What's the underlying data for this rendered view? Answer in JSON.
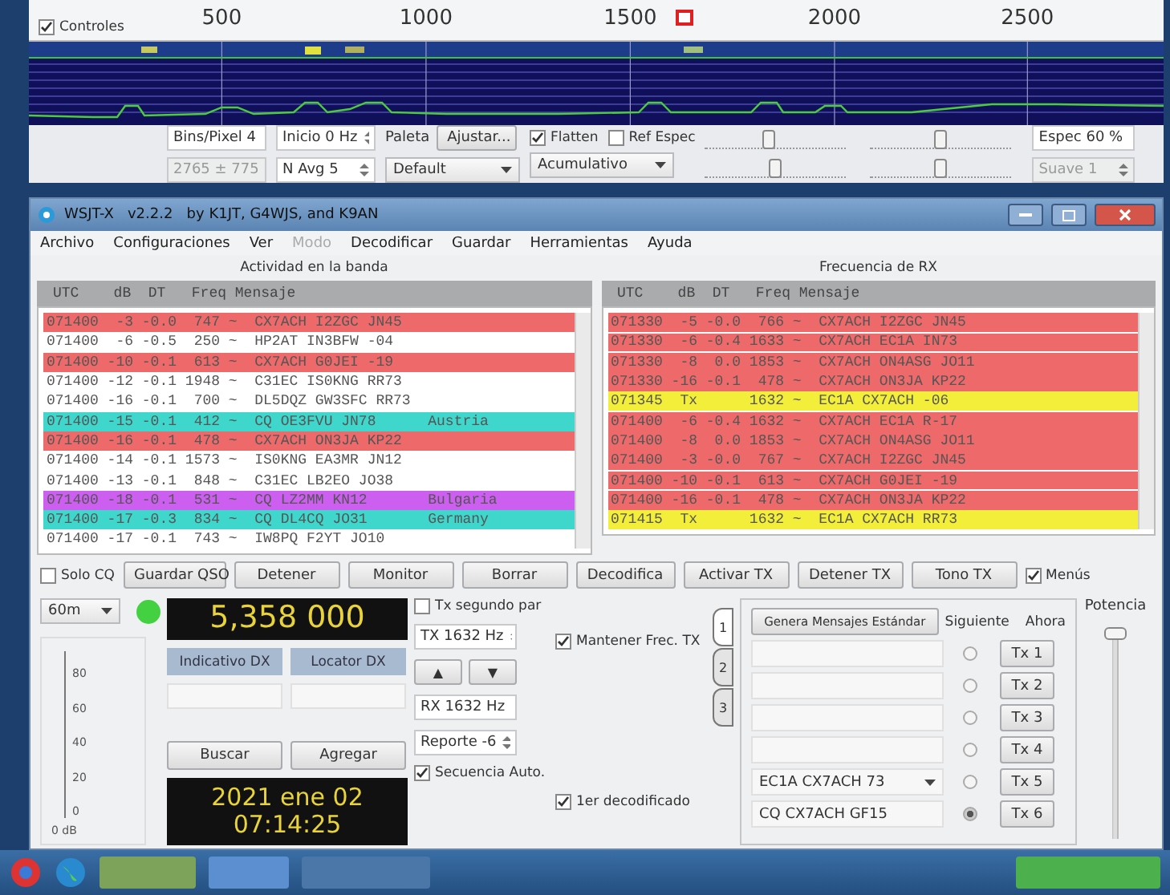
{
  "waterfall": {
    "controls": {
      "label": "Controles",
      "checked": true
    },
    "freq_labels": [
      "500",
      "1000",
      "1500",
      "2000",
      "2500"
    ],
    "bins_per_pixel": "Bins/Pixel 4",
    "start": "Inicio 0 Hz",
    "range": "2765 ± 775",
    "n_avg": "N Avg 5",
    "palette_label": "Paleta",
    "adjust_button": "Ajustar...",
    "palette": "Default",
    "flatten": {
      "label": "Flatten",
      "checked": true
    },
    "ref_spec": {
      "label": "Ref Espec",
      "checked": false
    },
    "mode": "Acumulativo",
    "sliders": [
      {
        "level": 0.45
      },
      {
        "level": 0.5
      },
      {
        "level": 0.5
      },
      {
        "level": 0.5
      }
    ],
    "spec": "Espec 60 %",
    "smooth": "Suave 1"
  },
  "window": {
    "title": "WSJT-X   v2.2.2   by K1JT, G4WJS, and K9AN"
  },
  "menu": [
    {
      "label": "Archivo",
      "disabled": false
    },
    {
      "label": "Configuraciones",
      "disabled": false
    },
    {
      "label": "Ver",
      "disabled": false
    },
    {
      "label": "Modo",
      "disabled": true
    },
    {
      "label": "Decodificar",
      "disabled": false
    },
    {
      "label": "Guardar",
      "disabled": false
    },
    {
      "label": "Herramientas",
      "disabled": false
    },
    {
      "label": "Ayuda",
      "disabled": false
    }
  ],
  "band_activity": {
    "title": "Actividad en la banda",
    "columns": [
      "UTC",
      "dB",
      "DT",
      "Freq",
      "Mensaje"
    ],
    "rows": [
      {
        "line": "071400  -3 -0.0  747 ~  CX7ACH I2ZGC JN45",
        "color": "#ee6a6a"
      },
      {
        "line": "071400  -6 -0.5  250 ~  HP2AT IN3BFW -04",
        "color": "#ffffff"
      },
      {
        "line": "071400 -10 -0.1  613 ~  CX7ACH G0JEI -19",
        "color": "#ee6a6a"
      },
      {
        "line": "071400 -12 -0.1 1948 ~  C31EC IS0KNG RR73",
        "color": "#ffffff"
      },
      {
        "line": "071400 -16 -0.1  700 ~  DL5DQZ GW3SFC RR73",
        "color": "#ffffff"
      },
      {
        "line": "071400 -15 -0.1  412 ~  CQ OE3FVU JN78",
        "country": "Austria",
        "color": "#3fd6cc"
      },
      {
        "line": "071400 -16 -0.1  478 ~  CX7ACH ON3JA KP22",
        "color": "#ee6a6a"
      },
      {
        "line": "071400 -14 -0.1 1573 ~  IS0KNG EA3MR JN12",
        "color": "#ffffff"
      },
      {
        "line": "071400 -13 -0.1  848 ~  C31EC LB2EO JO38",
        "color": "#ffffff"
      },
      {
        "line": "071400 -18 -0.1  531 ~  CQ LZ2MM KN12",
        "country": "Bulgaria",
        "color": "#cc5ff0"
      },
      {
        "line": "071400 -17 -0.3  834 ~  CQ DL4CQ JO31",
        "country": "Germany",
        "color": "#3fd6cc"
      },
      {
        "line": "071400 -17 -0.1  743 ~  IW8PQ F2YT JO10",
        "color": "#ffffff"
      }
    ]
  },
  "rx_frequency": {
    "title": "Frecuencia de RX",
    "columns": [
      "UTC",
      "dB",
      "DT",
      "Freq",
      "Mensaje"
    ],
    "rows": [
      {
        "line": "071330  -5 -0.0  766 ~  CX7ACH I2ZGC JN45",
        "color": "#ee6a6a"
      },
      {
        "line": "071330  -6 -0.4 1633 ~  CX7ACH EC1A IN73",
        "color": "#ee6a6a"
      },
      {
        "line": "071330  -8  0.0 1853 ~  CX7ACH ON4ASG JO11",
        "color": "#ee6a6a"
      },
      {
        "line": "071330 -16 -0.1  478 ~  CX7ACH ON3JA KP22",
        "color": "#ee6a6a"
      },
      {
        "line": "071345  Tx      1632 ~  EC1A CX7ACH -06",
        "color": "#f2ee3a"
      },
      {
        "line": "071400  -6 -0.4 1632 ~  CX7ACH EC1A R-17",
        "color": "#ee6a6a"
      },
      {
        "line": "071400  -8  0.0 1853 ~  CX7ACH ON4ASG JO11",
        "color": "#ee6a6a"
      },
      {
        "line": "071400  -3 -0.0  767 ~  CX7ACH I2ZGC JN45",
        "color": "#ee6a6a"
      },
      {
        "line": "071400 -10 -0.1  613 ~  CX7ACH G0JEI -19",
        "color": "#ee6a6a"
      },
      {
        "line": "071400 -16 -0.1  478 ~  CX7ACH ON3JA KP22",
        "color": "#ee6a6a"
      },
      {
        "line": "071415  Tx      1632 ~  EC1A CX7ACH RR73",
        "color": "#f2ee3a"
      }
    ]
  },
  "toolbar": {
    "cq_only": {
      "label": "Solo CQ",
      "checked": false
    },
    "buttons": [
      "Guardar QSO",
      "Detener",
      "Monitor",
      "Borrar",
      "Decodifica",
      "Activar TX",
      "Detener TX",
      "Tono TX"
    ],
    "menus": {
      "label": "Menús",
      "checked": true
    }
  },
  "band": "60m",
  "frequency": "5,358 000",
  "meter": {
    "ticks": [
      "80",
      "60",
      "40",
      "20",
      "0"
    ],
    "reading": "0 dB"
  },
  "dx": {
    "call_label": "Indicativo DX",
    "locator_label": "Locator DX",
    "lookup_button": "Buscar",
    "add_button": "Agregar"
  },
  "clock": {
    "date": "2021 ene 02",
    "time": "07:14:25"
  },
  "tx_controls": {
    "tx_even": {
      "label": "Tx segundo par",
      "checked": false
    },
    "tx_freq": "TX 1632 Hz",
    "hold_tx": {
      "label": "Mantener Frec. TX",
      "checked": true
    },
    "up": "▲",
    "down": "▼",
    "rx_freq": "RX 1632 Hz",
    "report": "Reporte -6",
    "auto_seq": {
      "label": "Secuencia Auto.",
      "checked": true
    },
    "first_decode": {
      "label": "1er decodificado",
      "checked": true
    }
  },
  "tabs": [
    {
      "label": "1",
      "selected": true
    },
    {
      "label": "2",
      "selected": false
    },
    {
      "label": "3",
      "selected": false
    }
  ],
  "messages": {
    "generate_button": "Genera Mensajes Estándar",
    "next_header": "Siguiente",
    "now_header": "Ahora",
    "rows": [
      {
        "value": "",
        "selected": false,
        "button": "Tx 1"
      },
      {
        "value": "",
        "selected": false,
        "button": "Tx 2"
      },
      {
        "value": "",
        "selected": false,
        "button": "Tx 3"
      },
      {
        "value": "",
        "selected": false,
        "button": "Tx 4"
      },
      {
        "kind": "dropdown",
        "value": "EC1A CX7ACH 73",
        "selected": false,
        "button": "Tx 5"
      },
      {
        "value": "CQ CX7ACH GF15",
        "selected": true,
        "button": "Tx 6"
      }
    ]
  },
  "power": {
    "label": "Potencia",
    "level": 1
  }
}
